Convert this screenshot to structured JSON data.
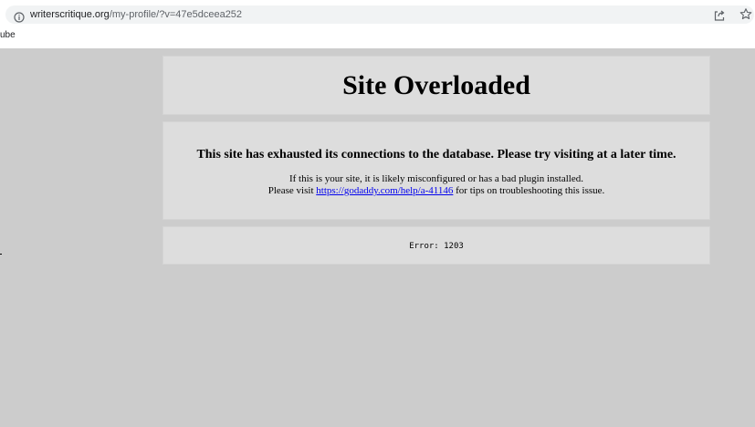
{
  "browser": {
    "url_domain": "writerscritique.org",
    "url_path": "/my-profile/?v=47e5dceea252",
    "bookmark_fragment": "ube"
  },
  "page": {
    "title": "Site Overloaded",
    "heading": "This site has exhausted its connections to the database. Please try visiting at a later time.",
    "body_line1": "If this is your site, it is likely misconfigured or has a bad plugin installed.",
    "body_line2_prefix": "Please visit ",
    "help_link": "https://godaddy.com/help/a-41146",
    "body_line2_suffix": " for tips on troubleshooting this issue.",
    "error": "Error: 1203"
  },
  "colors": {
    "viewport_bg": "#cccccc",
    "panel_bg": "#dddddd",
    "link": "#0000ee"
  },
  "icons": {
    "info": "info-icon",
    "share": "share-icon",
    "bookmark": "star-icon"
  }
}
